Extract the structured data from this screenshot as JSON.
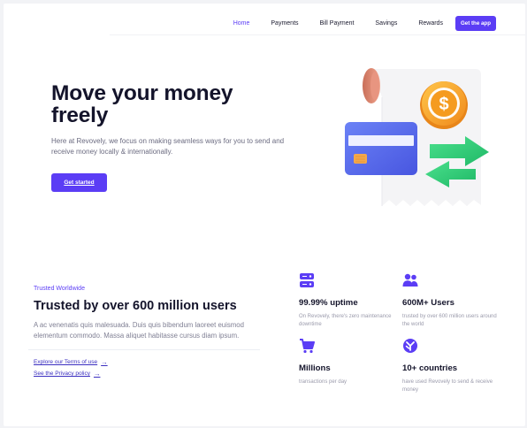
{
  "nav": {
    "items": [
      {
        "label": "Home",
        "active": true
      },
      {
        "label": "Payments",
        "active": false
      },
      {
        "label": "Bill Payment",
        "active": false
      },
      {
        "label": "Savings",
        "active": false
      },
      {
        "label": "Rewards",
        "active": false
      }
    ],
    "cta": "Get the app"
  },
  "hero": {
    "title": "Move your money freely",
    "description": "Here at Revovely, we focus on making seamless ways for you to send and receive money locally & internationally.",
    "cta": "Get started",
    "illustration_icons": [
      "receipt-icon",
      "dollar-coin-icon",
      "credit-card-icon",
      "transfer-arrows-icon"
    ]
  },
  "trusted": {
    "label": "Trusted Worldwide",
    "title": "Trusted by over 600 million users",
    "description": "A ac venenatis quis malesuada. Duis quis bibendum laoreet euismod elementum commodo. Massa aliquet habitasse cursus diam ipsum.",
    "links": [
      {
        "label": "Explore our Terms of use",
        "arrow": "→"
      },
      {
        "label": "See the Privacy policy",
        "arrow": "→"
      }
    ]
  },
  "stats": [
    {
      "icon": "server-icon",
      "title": "99.99% uptime",
      "description": "On Revovely, there's zero maintenance downtime"
    },
    {
      "icon": "users-icon",
      "title": "600M+ Users",
      "description": "trusted by over 600 million users around the world"
    },
    {
      "icon": "cart-icon",
      "title": "Millions",
      "description": "transactions per day"
    },
    {
      "icon": "globe-icon",
      "title": "10+ countries",
      "description": "have used Revovely to send & receive money"
    }
  ],
  "colors": {
    "accent": "#5b3df5",
    "heading": "#14142b",
    "body": "#6b6b80",
    "coin": "#f5a623",
    "card": "#5b6ff0",
    "arrows": "#2fd17a"
  }
}
